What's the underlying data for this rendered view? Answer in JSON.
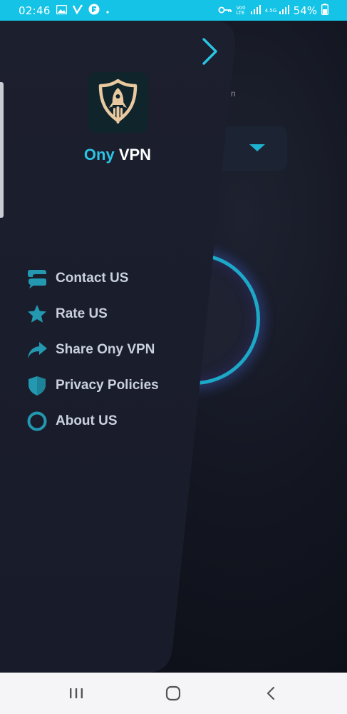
{
  "status_bar": {
    "time": "02:46",
    "battery_text": "54%",
    "network_label_1": "Vo0 LTE",
    "network_label_2": "4.5G",
    "icons": [
      "gallery-icon",
      "v-app-icon",
      "flipboard-icon",
      "dot-icon",
      "vpn-key-icon",
      "signal-icon",
      "battery-icon"
    ]
  },
  "drawer": {
    "brand_first": "Ony",
    "brand_second": " VPN",
    "menu": [
      {
        "id": "contact",
        "label": "Contact US",
        "icon": "chat-icon"
      },
      {
        "id": "rate",
        "label": "Rate US",
        "icon": "star-icon"
      },
      {
        "id": "share",
        "label": "Share Ony VPN",
        "icon": "share-icon"
      },
      {
        "id": "privacy",
        "label": "Privacy Policies",
        "icon": "shield-icon"
      },
      {
        "id": "about",
        "label": "About US",
        "icon": "circle-icon"
      }
    ]
  },
  "background_app": {
    "hint_text": "n"
  },
  "colors": {
    "accent": "#2bc4e4",
    "status_bar": "#14c3e5",
    "drawer_bg": "#1a1d2b",
    "menu_text": "#c9d1dc",
    "menu_icon": "#2398b0",
    "logo_gold": "#e8c9a0"
  },
  "nav_bar": {
    "buttons": [
      "recents-icon",
      "home-icon",
      "back-icon"
    ]
  }
}
